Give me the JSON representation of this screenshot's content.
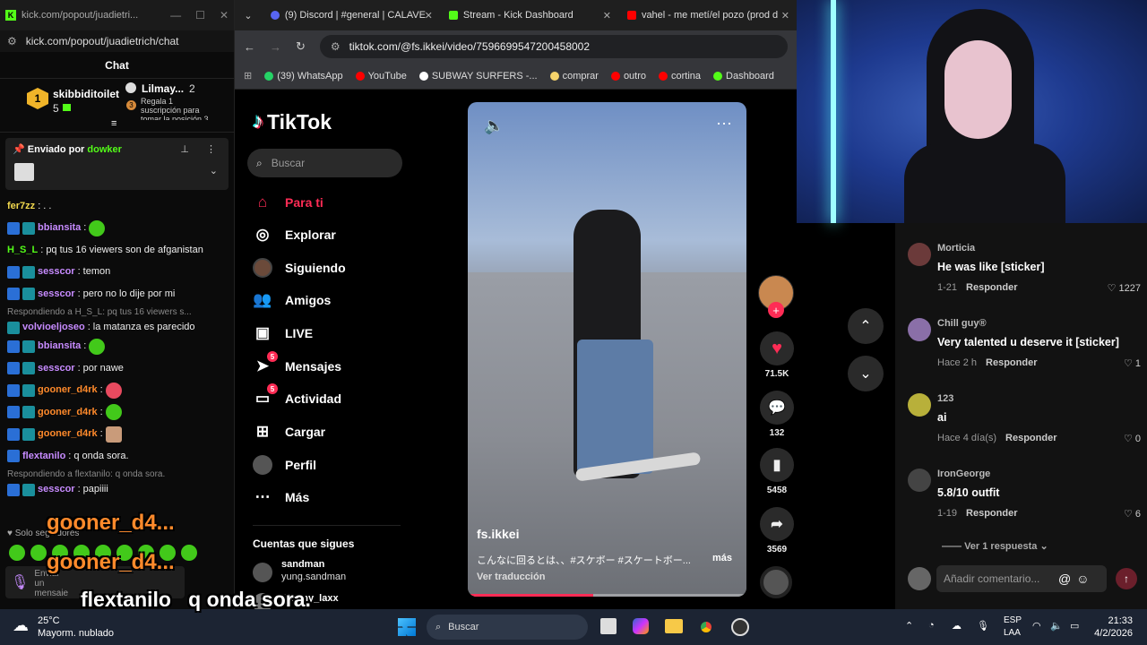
{
  "chat_window": {
    "title": "kick.com/popout/juadietri...",
    "url": "kick.com/popout/juadietrich/chat",
    "header": "Chat",
    "gifter1": {
      "name": "skibbiditoilet",
      "rank": "1",
      "count": "5"
    },
    "gifter2": {
      "name": "Lilmay...",
      "count": "2",
      "hint": "Regala 1 suscripción para tomar la posición 3",
      "rank": "3"
    },
    "pinned_label": "Enviado por",
    "pinned_user": "dowker",
    "messages": [
      {
        "user": "fer7zz",
        "text": ". .",
        "color": "#f2d94e"
      },
      {
        "user": "bbiansita",
        "text": "",
        "color": "#c78bff",
        "emote": true
      },
      {
        "user": "H_S_L",
        "text": "pq tus 16 viewers son de afganistan",
        "color": "#53fc18"
      },
      {
        "user": "sesscor",
        "text": "temon",
        "color": "#c78bff"
      },
      {
        "user": "sesscor",
        "text": "pero no lo dije por mi",
        "color": "#c78bff"
      }
    ],
    "reply1": "Respondiendo a H_S_L: pq tus 16 viewers s...",
    "msg_volvio": {
      "user": "volvioeljoseo",
      "text": "la matanza es parecido"
    },
    "msg_bbi2": {
      "user": "bbiansita",
      "text": ""
    },
    "msg_ses3": {
      "user": "sesscor",
      "text": "por nawe"
    },
    "gooner_user": "gooner_d4rk",
    "msg_flex": {
      "user": "flextanilo",
      "text": "q onda sora."
    },
    "reply2": "Respondiendo a flextanilo: q onda sora.",
    "msg_ses4": {
      "user": "sesscor",
      "text": "papiiii"
    },
    "followers_only": "Solo seguidores",
    "send_placeholder": "Enviar un mensaje",
    "overlay_gooner": "gooner_d4...",
    "overlay_line": "flextanilo   q onda sora."
  },
  "browser": {
    "tabs": [
      {
        "title": "(9) Discord | #general | CALAVE",
        "color": "#5865f2"
      },
      {
        "title": "Stream - Kick Dashboard",
        "color": "#53fc18"
      },
      {
        "title": "vahel - me metí/el pozo (prod d",
        "color": "#ff0000"
      }
    ],
    "url": "tiktok.com/@fs.ikkei/video/7596699547200458002",
    "bookmarks": [
      {
        "label": "(39) WhatsApp",
        "color": "#25d366"
      },
      {
        "label": "YouTube",
        "color": "#ff0000"
      },
      {
        "label": "SUBWAY SURFERS -...",
        "color": "#ffffff"
      },
      {
        "label": "comprar",
        "color": "#f5d36b"
      },
      {
        "label": "outro",
        "color": "#ff0000"
      },
      {
        "label": "cortina",
        "color": "#ff0000"
      },
      {
        "label": "Dashboard",
        "color": "#53fc18"
      }
    ]
  },
  "tiktok": {
    "logo": "TikTok",
    "search_placeholder": "Buscar",
    "nav": [
      {
        "label": "Para ti",
        "icon": "home-icon",
        "active": true
      },
      {
        "label": "Explorar",
        "icon": "compass-icon"
      },
      {
        "label": "Siguiendo",
        "icon": "following-avatar-icon"
      },
      {
        "label": "Amigos",
        "icon": "friends-icon"
      },
      {
        "label": "LIVE",
        "icon": "live-icon"
      },
      {
        "label": "Mensajes",
        "icon": "messages-icon",
        "badge": "5"
      },
      {
        "label": "Actividad",
        "icon": "activity-icon",
        "badge": "5"
      },
      {
        "label": "Cargar",
        "icon": "upload-icon"
      },
      {
        "label": "Perfil",
        "icon": "profile-icon"
      },
      {
        "label": "Más",
        "icon": "more-icon"
      }
    ],
    "following_header": "Cuentas que sigues",
    "following": [
      {
        "name": "sandman",
        "handle": "yung.sandman"
      },
      {
        "name": "Skinny_laxx",
        "handle": ""
      }
    ],
    "video": {
      "author": "fs.ikkei",
      "caption": "こんなに回るとは、、#スケボー #スケートボー...",
      "more": "más",
      "translate": "Ver traducción",
      "progress": 0.45
    },
    "actions": {
      "likes": "71.5K",
      "comments": "132",
      "saves": "5458",
      "shares": "3569"
    },
    "comments": [
      {
        "name": "Morticia",
        "text": "He was like [sticker]",
        "date": "1-21",
        "reply": "Responder",
        "likes": "1227",
        "avatar": "#6b3a3a"
      },
      {
        "name": "Chill guy®",
        "text": "Very talented u deserve it [sticker]",
        "date": "Hace 2 h",
        "reply": "Responder",
        "likes": "1",
        "avatar": "#8a6fa8"
      },
      {
        "name": "123",
        "text": "ai",
        "date": "Hace 4 día(s)",
        "reply": "Responder",
        "likes": "0",
        "avatar": "#b8b03a"
      },
      {
        "name": "IronGeorge",
        "text": "5.8/10 outfit",
        "date": "1-19",
        "reply": "Responder",
        "likes": "6",
        "avatar": "#444444"
      }
    ],
    "view_replies": "Ver 1 respuesta",
    "add_comment_placeholder": "Añadir comentario..."
  },
  "taskbar": {
    "weather_temp": "25°C",
    "weather_desc": "Mayorm. nublado",
    "search": "Buscar",
    "lang1": "ESP",
    "lang2": "LAA",
    "time": "21:33",
    "date": "4/2/2026"
  }
}
